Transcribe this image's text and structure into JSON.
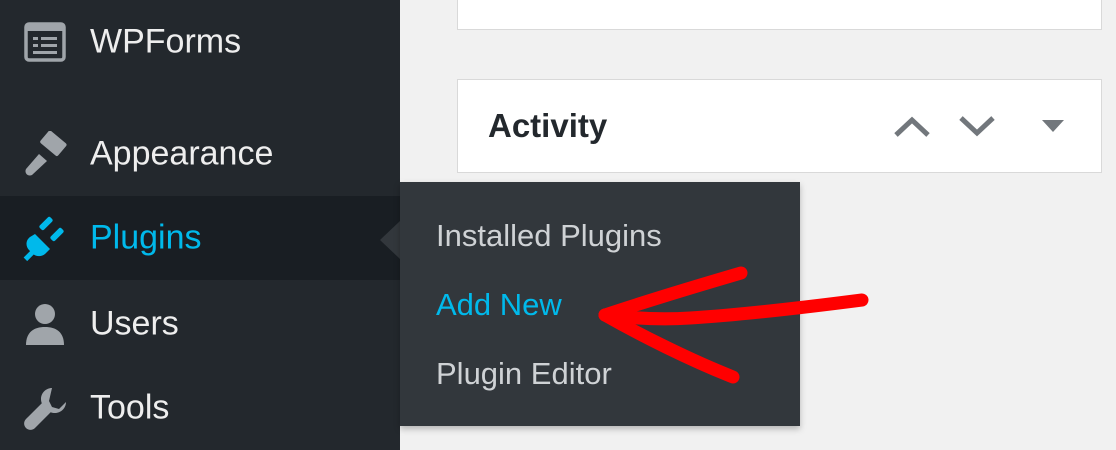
{
  "sidebar": {
    "items": [
      {
        "label": "WPForms",
        "icon": "wpforms-icon"
      },
      {
        "label": "Appearance",
        "icon": "paintbrush-icon"
      },
      {
        "label": "Plugins",
        "icon": "plug-icon",
        "active": true
      },
      {
        "label": "Users",
        "icon": "user-icon"
      },
      {
        "label": "Tools",
        "icon": "wrench-icon"
      }
    ]
  },
  "flyout": {
    "items": [
      {
        "label": "Installed Plugins"
      },
      {
        "label": "Add New",
        "current": true
      },
      {
        "label": "Plugin Editor"
      }
    ]
  },
  "activity": {
    "title": "Activity",
    "controls": [
      "move-up-icon",
      "move-down-icon",
      "toggle-panel-icon"
    ]
  },
  "annotation": {
    "icon": "red-arrow-icon",
    "color": "#ff0000"
  },
  "colors": {
    "sidebar_bg": "#23282d",
    "active_bg": "#191e23",
    "flyout_bg": "#32373c",
    "accent": "#00b9eb",
    "content_bg": "#f1f1f1"
  }
}
